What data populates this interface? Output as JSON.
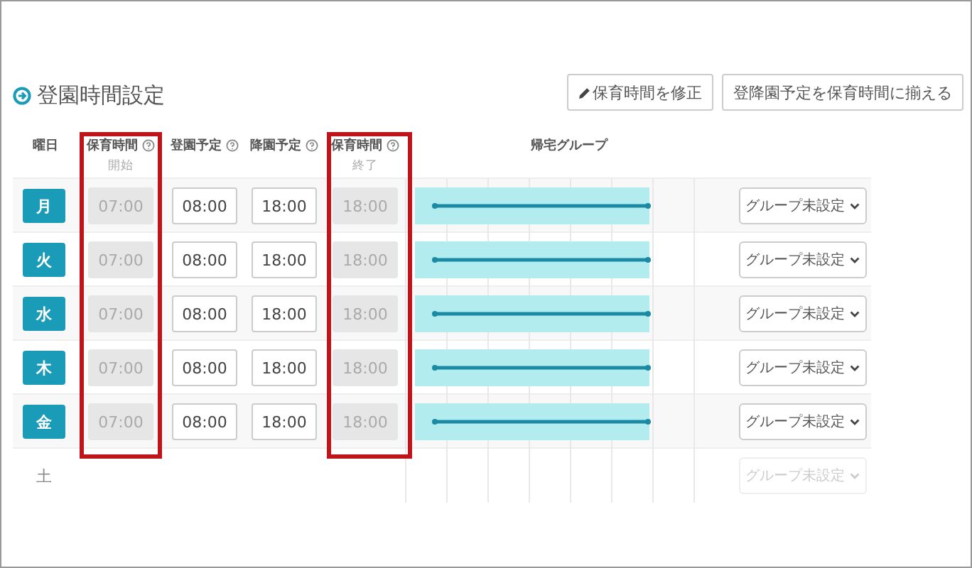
{
  "title": "登園時間設定",
  "buttons": [
    {
      "label": "保育時間を修正",
      "kind": "edit"
    },
    {
      "label": "登降園予定を保育時間に揃える",
      "kind": "plain"
    }
  ],
  "columns": [
    {
      "label": "曜日"
    },
    {
      "label": "保育時間",
      "help": true,
      "sub": "開始",
      "highlighted": true
    },
    {
      "label": "登園予定",
      "help": true
    },
    {
      "label": "降園予定",
      "help": true
    },
    {
      "label": "保育時間",
      "help": true,
      "sub": "終了",
      "highlighted": true
    },
    {
      "label": "帰宅グループ"
    }
  ],
  "rows": [
    {
      "day": "月",
      "disabled": false,
      "care_start": "07:00",
      "arrival": "08:00",
      "departure": "18:00",
      "care_end": "18:00",
      "group": "グループ未設定"
    },
    {
      "day": "火",
      "disabled": false,
      "care_start": "07:00",
      "arrival": "08:00",
      "departure": "18:00",
      "care_end": "18:00",
      "group": "グループ未設定"
    },
    {
      "day": "水",
      "disabled": false,
      "care_start": "07:00",
      "arrival": "08:00",
      "departure": "18:00",
      "care_end": "18:00",
      "group": "グループ未設定"
    },
    {
      "day": "木",
      "disabled": false,
      "care_start": "07:00",
      "arrival": "08:00",
      "departure": "18:00",
      "care_end": "18:00",
      "group": "グループ未設定"
    },
    {
      "day": "金",
      "disabled": false,
      "care_start": "07:00",
      "arrival": "08:00",
      "departure": "18:00",
      "care_end": "18:00",
      "group": "グループ未設定"
    },
    {
      "day": "土",
      "disabled": true,
      "group": "グループ未設定"
    }
  ]
}
